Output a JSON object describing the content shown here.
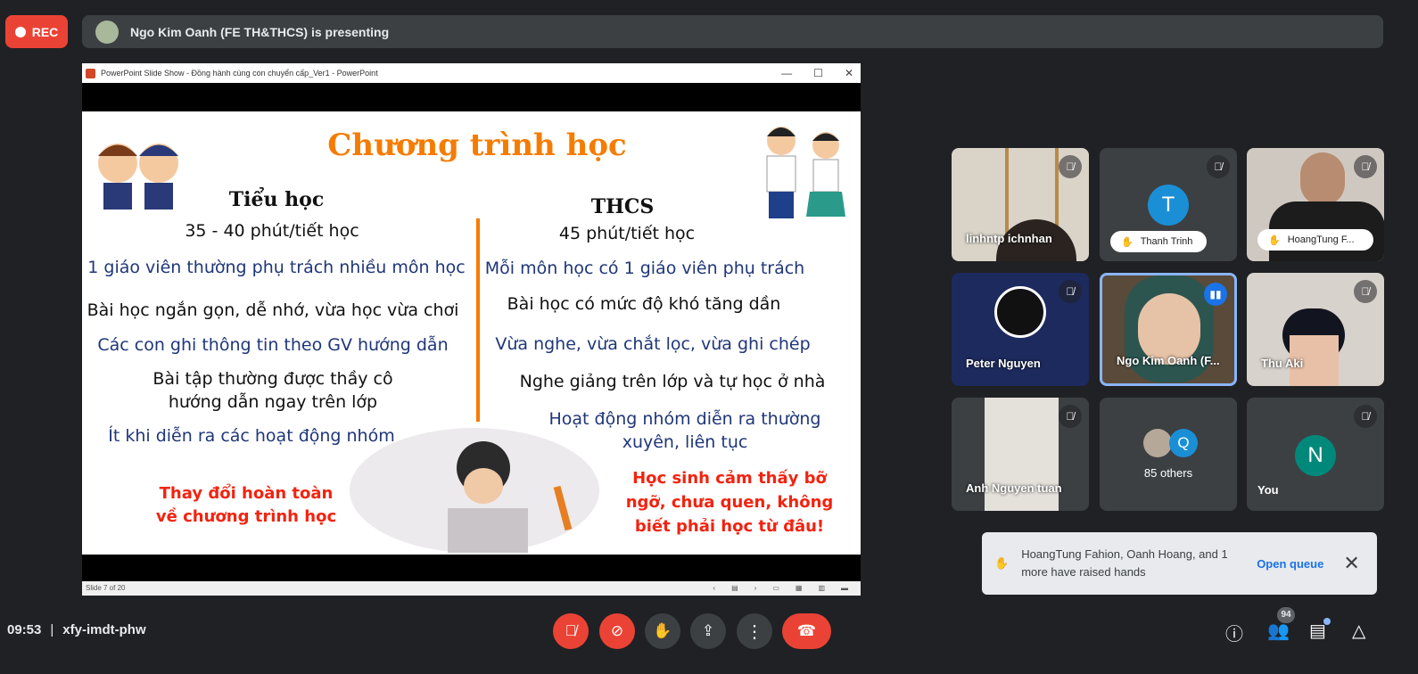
{
  "recording": {
    "label": "REC",
    "color": "#ea4335"
  },
  "presenting": {
    "text": "Ngo Kim Oanh (FE TH&THCS) is presenting"
  },
  "ppt": {
    "window_title": "PowerPoint Slide Show  -  Đồng hành cùng con chuyển cấp_Ver1 - PowerPoint",
    "controls": [
      "—",
      "☐",
      "✕"
    ],
    "status": "Slide 7 of 20",
    "slide": {
      "title": "Chương trình học",
      "left": {
        "heading": "Tiểu học",
        "duration": "35 - 40 phút/tiết học",
        "items": [
          "1 giáo viên thường phụ trách nhiều môn học",
          "Bài học ngắn gọn, dễ nhớ, vừa học vừa chơi",
          "Các con ghi thông tin theo GV hướng dẫn",
          "Bài tập thường được thầy cô",
          "hướng dẫn ngay trên lớp",
          "Ít khi diễn ra các hoạt động nhóm"
        ],
        "conclusion": [
          "Thay đổi hoàn toàn",
          "về chương trình học"
        ]
      },
      "right": {
        "heading": "THCS",
        "duration": "45 phút/tiết học",
        "items": [
          "Mỗi môn học có 1 giáo viên phụ trách",
          "Bài học có mức độ khó tăng dần",
          "Vừa nghe, vừa chắt lọc, vừa ghi chép",
          "Nghe giảng trên lớp và tự học ở nhà",
          "Hoạt động nhóm diễn ra thường",
          "xuyên, liên tục"
        ],
        "conclusion": [
          "Học sinh cảm thấy bỡ",
          "ngỡ, chưa quen, không",
          "biết phải học từ đâu!"
        ]
      }
    }
  },
  "participants": [
    {
      "name": "linhntp ichnhan",
      "muted": true
    },
    {
      "name": "Thanh Trinh",
      "initial": "T",
      "hand_raised": true,
      "muted": true,
      "color": "#1a8fd6"
    },
    {
      "name": "HoangTung F...",
      "hand_raised": true,
      "muted": true
    },
    {
      "name": "Peter Nguyen",
      "muted": true
    },
    {
      "name": "Ngo Kim Oanh (F...",
      "speaking": true
    },
    {
      "name": "Thu Aki",
      "muted": true
    },
    {
      "name": "Anh Nguyen tuan",
      "muted": true
    },
    {
      "name": "85 others",
      "initial": "Q"
    },
    {
      "name": "You",
      "initial": "N",
      "muted": true,
      "color": "#00897b"
    }
  ],
  "toast": {
    "message": "HoangTung Fahion, Oanh Hoang, and 1 more have raised hands",
    "action": "Open queue"
  },
  "bottom": {
    "time": "09:53",
    "separator": "|",
    "meeting_code": "xfy-imdt-phw",
    "people_count": "94"
  }
}
